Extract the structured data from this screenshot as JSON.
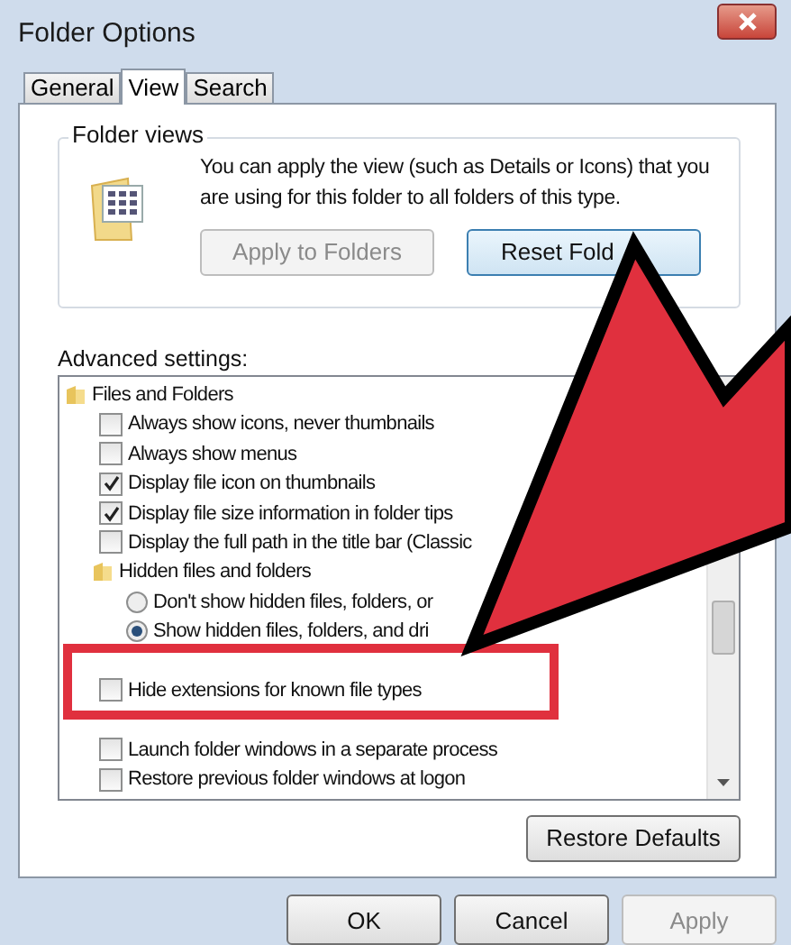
{
  "window": {
    "title": "Folder Options"
  },
  "tabs": [
    {
      "label": "General",
      "selected": false
    },
    {
      "label": "View",
      "selected": true
    },
    {
      "label": "Search",
      "selected": false
    }
  ],
  "folder_views": {
    "title": "Folder views",
    "description": "You can apply the view (such as Details or Icons) that you are using for this folder to all folders of this type.",
    "buttons": [
      {
        "label": "Apply to Folders",
        "disabled": true
      },
      {
        "label": "Reset Fold",
        "disabled": false
      }
    ]
  },
  "advanced": {
    "label": "Advanced settings:",
    "items": [
      {
        "kind": "folder",
        "label": "Files and Folders",
        "children": [
          {
            "kind": "checkbox",
            "label": "Always show icons, never thumbnails",
            "checked": false
          },
          {
            "kind": "checkbox",
            "label": "Always show menus",
            "checked": false
          },
          {
            "kind": "checkbox",
            "label": "Display file icon on thumbnails",
            "checked": true
          },
          {
            "kind": "checkbox",
            "label": "Display file size information in folder tips",
            "checked": true
          },
          {
            "kind": "checkbox",
            "label": "Display the full path in the title bar (Classic",
            "checked": false
          },
          {
            "kind": "folder",
            "label": "Hidden files and folders",
            "children": [
              {
                "kind": "radio",
                "label": "Don't show hidden files, folders, or",
                "selected": false
              },
              {
                "kind": "radio",
                "label": "Show hidden files, folders, and dri",
                "selected": true
              }
            ]
          },
          {
            "kind": "covered"
          },
          {
            "kind": "checkbox",
            "label": "Hide extensions for known file types",
            "checked": false
          },
          {
            "kind": "covered"
          },
          {
            "kind": "checkbox",
            "label": "Launch folder windows in a separate process",
            "checked": false
          },
          {
            "kind": "checkbox",
            "label": "Restore previous folder windows at logon",
            "checked": false
          }
        ]
      }
    ]
  },
  "restore_button": "Restore Defaults",
  "buttons": [
    {
      "label": "OK",
      "disabled": false
    },
    {
      "label": "Cancel",
      "disabled": false
    },
    {
      "label": "Apply",
      "disabled": true
    }
  ]
}
